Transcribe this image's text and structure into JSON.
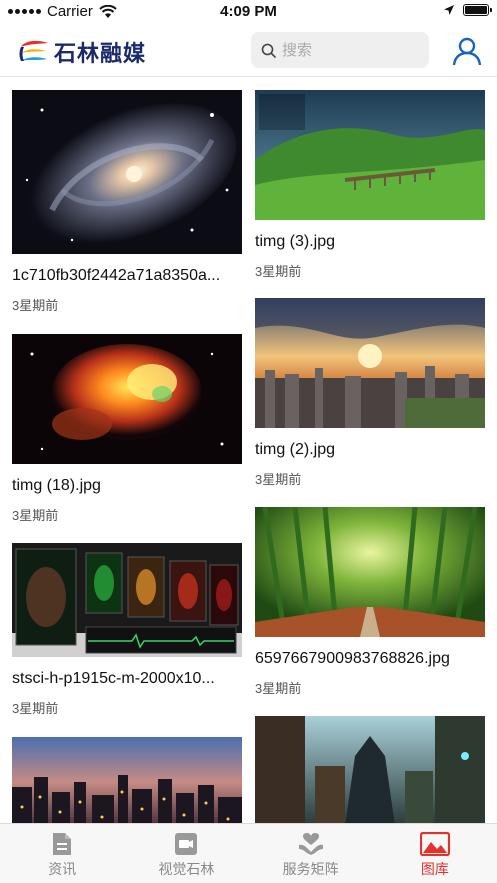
{
  "status_bar": {
    "carrier": "Carrier",
    "time": "4:09 PM"
  },
  "header": {
    "logo_text": "石林融媒",
    "search_placeholder": "搜索",
    "brand_colors": {
      "blue": "#1a2a6c",
      "red": "#e4312b",
      "yellow": "#f4b400",
      "cyan": "#1fa2d8"
    }
  },
  "gallery": {
    "items": [
      {
        "name": "1c710fb30f2442a71a8350a...",
        "time": "3星期前",
        "image": "spiral-galaxy"
      },
      {
        "name": "timg (3).jpg",
        "time": "3星期前",
        "image": "green-hills-viaduct"
      },
      {
        "name": "timg (18).jpg",
        "time": "3星期前",
        "image": "colorful-nebula"
      },
      {
        "name": "timg (2).jpg",
        "time": "3星期前",
        "image": "city-sunset"
      },
      {
        "name": "stsci-h-p1915c-m-2000x10...",
        "time": "3星期前",
        "image": "spectral-panels"
      },
      {
        "name": "6597667900983768826.jpg",
        "time": "3星期前",
        "image": "bamboo-forest"
      },
      {
        "name": "",
        "time": "",
        "image": "night-city-skyline"
      },
      {
        "name": "",
        "time": "",
        "image": "fantasy-town"
      }
    ]
  },
  "tabbar": {
    "tabs": [
      {
        "label": "资讯",
        "icon": "news-icon"
      },
      {
        "label": "视觉石林",
        "icon": "video-icon"
      },
      {
        "label": "服务矩阵",
        "icon": "heart-hands-icon"
      },
      {
        "label": "图库",
        "icon": "gallery-icon",
        "active": true
      }
    ],
    "active_color": "#e4312b"
  }
}
